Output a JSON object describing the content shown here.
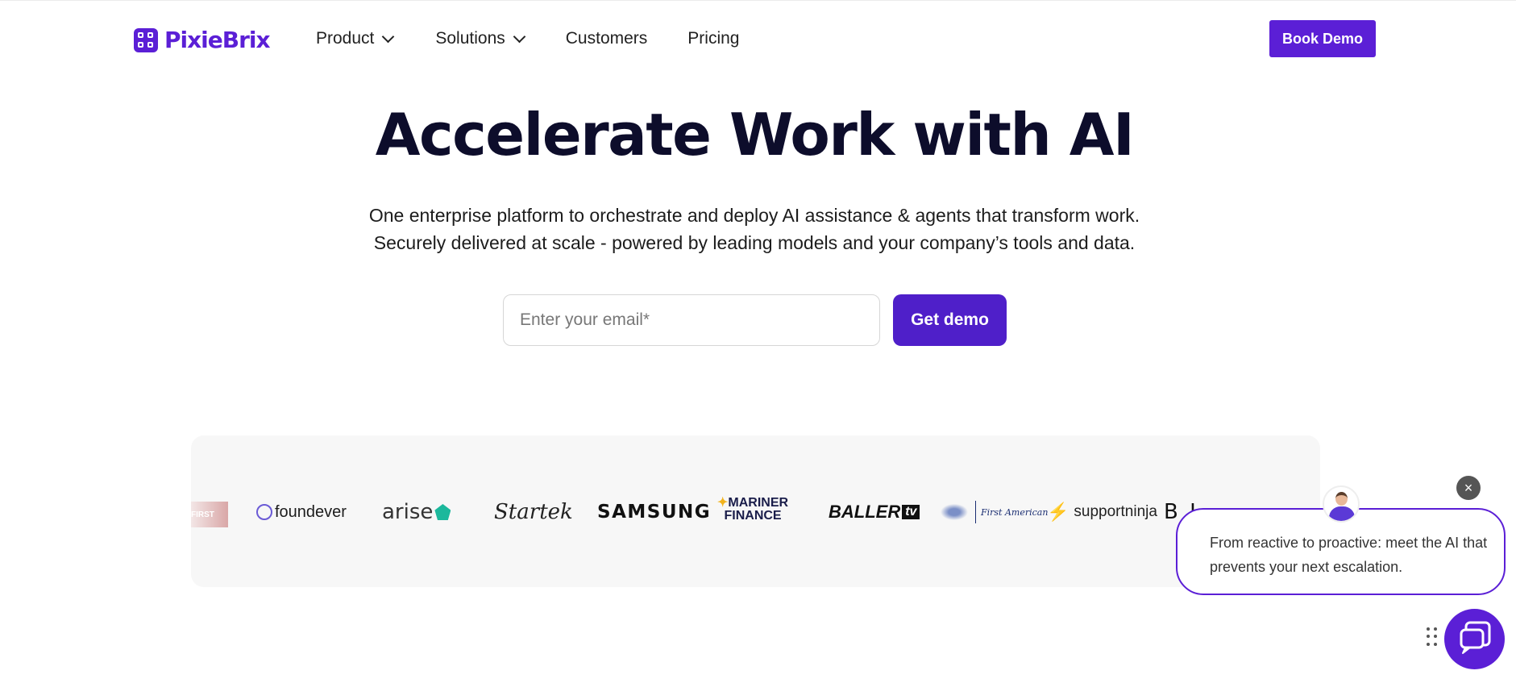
{
  "nav": {
    "logo_text": "PixieBrix",
    "items": [
      {
        "label": "Product",
        "has_dropdown": true
      },
      {
        "label": "Solutions",
        "has_dropdown": true
      },
      {
        "label": "Customers",
        "has_dropdown": false
      },
      {
        "label": "Pricing",
        "has_dropdown": false
      }
    ],
    "book_demo_label": "Book Demo"
  },
  "hero": {
    "title": "Accelerate Work with AI",
    "subtitle_line1": "One enterprise platform to orchestrate and deploy AI assistance & agents that transform work.",
    "subtitle_line2": "Securely delivered at scale - powered by leading models and your company’s tools and data.",
    "email_placeholder": "Enter your email*",
    "email_value": "",
    "cta_label": "Get demo"
  },
  "customer_logos": {
    "first_partial": "FIRST",
    "foundever": "foundever",
    "arise": "arise",
    "startek": "Startek",
    "samsung": "SAMSUNG",
    "mariner_line1": "MARINER",
    "mariner_line2": "FINANCE",
    "baller": "BALLER",
    "baller_tv": "tv",
    "first_american": "First American",
    "supportninja": "supportninja",
    "truncated": "B L"
  },
  "chat_widget": {
    "close_glyph": "×",
    "message": "From reactive to proactive: meet the AI that prevents your next escalation."
  },
  "colors": {
    "brand": "#5b1fd6",
    "cta": "#4f1fc9",
    "heading": "#0d0d2b",
    "strip_bg": "#f7f7f7"
  },
  "icons": [
    "pixiebrix-logo-icon",
    "chevron-down-icon",
    "close-icon",
    "chat-icon",
    "drag-grip-icon"
  ]
}
